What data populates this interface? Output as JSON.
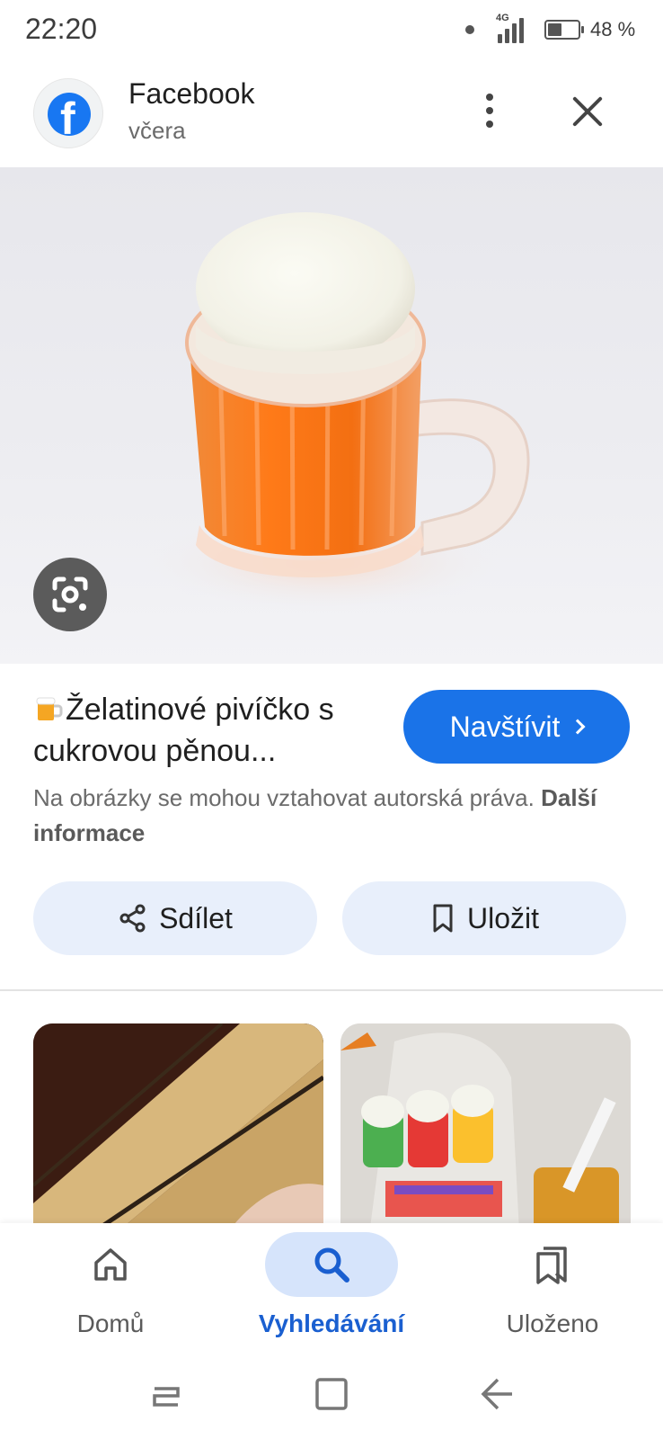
{
  "status_bar": {
    "time": "22:20",
    "network": "4G",
    "battery_text": "48 %",
    "battery_level": 0.48
  },
  "header": {
    "source_title": "Facebook",
    "source_subtitle": "včera",
    "source_icon": "facebook-logo",
    "more_icon": "more-vert-icon",
    "close_icon": "close-icon"
  },
  "result": {
    "title": "Želatinové pivíčko s cukrovou pěnou...",
    "title_emoji": "beer-mug-emoji",
    "visit_label": "Navštívit",
    "copyright_text": "Na obrázky se mohou vztahovat autorská práva.",
    "copyright_link": "Další informace"
  },
  "actions": {
    "share_label": "Sdílet",
    "save_label": "Uložit"
  },
  "bottom_nav": {
    "items": [
      {
        "label": "Domů",
        "icon": "home-icon",
        "active": false
      },
      {
        "label": "Vyhledávání",
        "icon": "search-icon",
        "active": true
      },
      {
        "label": "Uloženo",
        "icon": "bookmarks-icon",
        "active": false
      }
    ]
  },
  "system_nav": {
    "recents_icon": "recents-icon",
    "home_icon": "home-square-icon",
    "back_icon": "back-icon"
  },
  "colors": {
    "accent": "#1a73e8",
    "action_bg": "#e8effb",
    "nav_active_bg": "#d6e4fb"
  }
}
